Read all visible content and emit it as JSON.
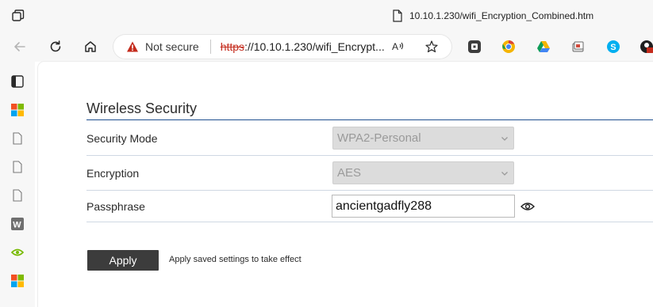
{
  "browser": {
    "tab_title": "10.10.1.230/wifi_Encryption_Combined.htm",
    "security_label": "Not secure",
    "url_scheme": "https",
    "url_rest": "://10.10.1.230/wifi_Encrypt...",
    "icons": {
      "app": "tab-actions-icon",
      "doc": "document-icon",
      "back": "back-arrow-icon",
      "reload": "reload-icon",
      "home": "home-icon",
      "warning": "warning-icon",
      "read_aloud": "read-aloud-icon",
      "favorite": "star-icon"
    },
    "extensions": [
      "extension-icon",
      "chrome-icon",
      "google-drive-icon",
      "collections-icon",
      "skype-icon",
      "profile-icon"
    ],
    "colors": {
      "warning": "#c42b1c",
      "chrome_bg": "#f7f7f7"
    }
  },
  "sidebar": {
    "items": [
      "vertical-tabs-icon",
      "windows-logo-icon",
      "page-icon",
      "page-icon",
      "page-icon",
      "w-app-icon",
      "nvidia-icon",
      "windows-logo-icon"
    ]
  },
  "page": {
    "section_title": "Wireless Security",
    "rows": [
      {
        "label": "Security Mode",
        "value": "WPA2-Personal",
        "disabled": true
      },
      {
        "label": "Encryption",
        "value": "AES",
        "disabled": true
      },
      {
        "label": "Passphrase",
        "value": "ancientgadfly288"
      }
    ],
    "apply_label": "Apply",
    "apply_note": "Apply saved settings to take effect",
    "colors": {
      "rule": "#1f4f8f",
      "apply_button": "#3c3c3c",
      "disabled_select": "#dcdcdc"
    }
  }
}
